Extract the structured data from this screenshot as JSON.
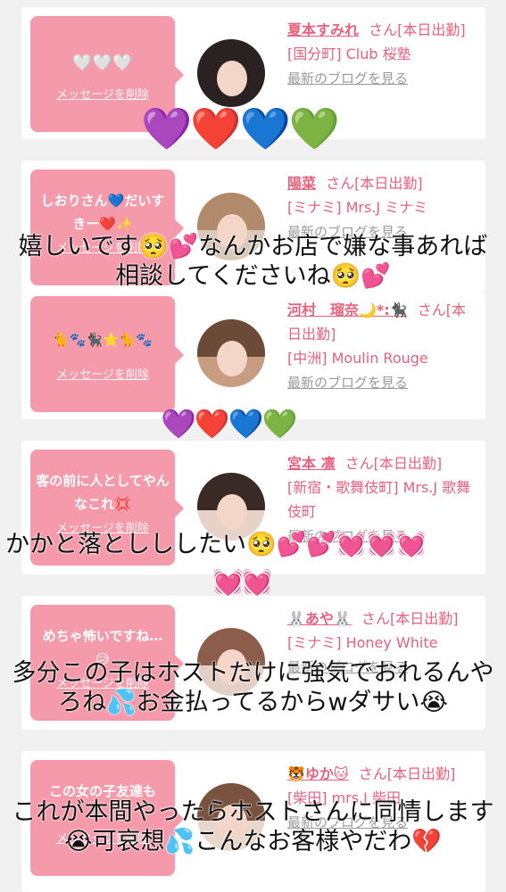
{
  "cards": [
    {
      "bubble_message": "🤍🤍🤍",
      "delete_label": "メッセージを削除",
      "name": "夏本すみれ",
      "suffix": "さん[本日出勤]",
      "shop": "[国分町] Club 桜塾",
      "blog_label": "最新のブログを見る"
    },
    {
      "bubble_message": "しおりさん💙だいすきー❤️✨",
      "delete_label": "メッセージを削除",
      "name": "陽菜",
      "suffix": "さん[本日出勤]",
      "shop": "[ミナミ] Mrs.J ミナミ",
      "blog_label": "最新のブログを見る"
    },
    {
      "bubble_message": "🐈🐾🐈‍⬛⭐🐈🐾",
      "delete_label": "メッセージを削除",
      "name": "河村　瑠奈🌙*:🐈‍⬛",
      "suffix": "さん[本日出勤]",
      "shop": "[中洲] Moulin Rouge",
      "blog_label": "最新のブログを見る"
    },
    {
      "bubble_message": "客の前に人としてやんなこれ💢",
      "delete_label": "メッセージを削除",
      "name": "宮本 凛",
      "suffix": "さん[本日出勤]",
      "shop": "[新宿・歌舞伎町] Mrs.J 歌舞伎町",
      "blog_label": "最新のブログを見る"
    },
    {
      "bubble_message": "めちゃ怖いですね…😥",
      "delete_label": "メッセージを削除",
      "name": "🐰あや🐰",
      "suffix": "さん[本日出勤]",
      "shop": "[ミナミ] Honey White",
      "blog_label": "最新のブログを見る"
    },
    {
      "bubble_message": "この女の子友達も",
      "delete_label": "メッセージを削除",
      "name": "🐯ゆか🐱",
      "suffix": "さん[本日出勤]",
      "shop": "[柴田] mrs.J 柴田",
      "blog_label": "最新のブログを見る"
    }
  ],
  "overlays": {
    "hearts_1": "💜❤️💙💚",
    "text_1": "嬉しいです🥺💕なんかお店で嫌な事あれば相談してくださいね🥺💕",
    "hearts_2": "💜❤️💙💚",
    "text_2": "かかと落としししたい🥺💕💕💓💓💓",
    "hearts_3": "💓💓",
    "text_3": "多分この子はホストだけに強気でおれるんやろね💦お金払ってるからwダサい😭",
    "text_4": "これが本間やったらホストさんに同情します😭可哀想💦こんなお客様やだわ💔"
  },
  "colors": {
    "accent": "#e8607e",
    "bubble": "#f59aaa",
    "background": "#f1f1f1"
  }
}
